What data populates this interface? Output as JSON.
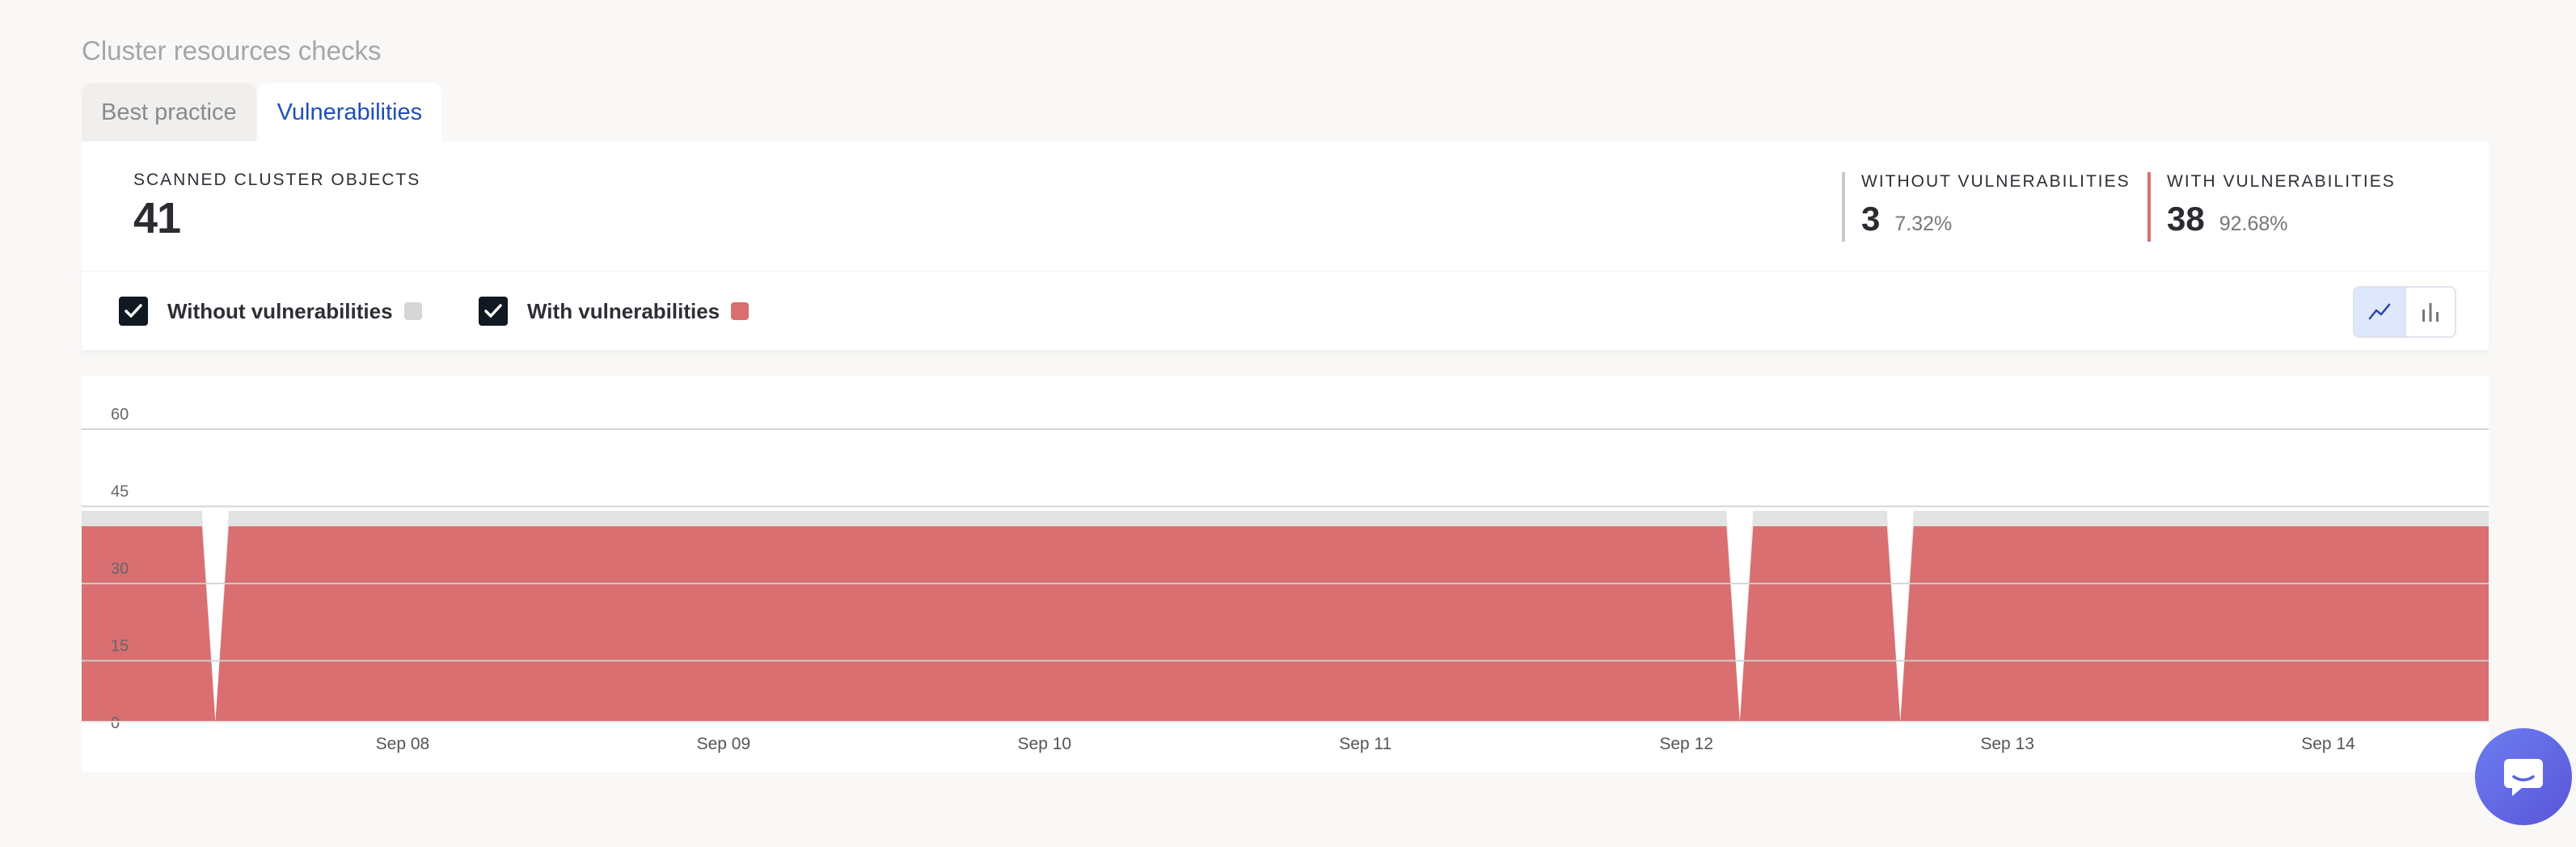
{
  "section": {
    "title": "Cluster resources checks"
  },
  "tabs": [
    {
      "label": "Best practice",
      "active": false
    },
    {
      "label": "Vulnerabilities",
      "active": true
    }
  ],
  "stats": {
    "scanned": {
      "label": "Scanned cluster objects",
      "value": "41"
    },
    "without": {
      "label": "Without vulnerabilities",
      "value": "3",
      "percent": "7.32%",
      "color": "#c9c9c9"
    },
    "with": {
      "label": "With vulnerabilities",
      "value": "38",
      "percent": "92.68%",
      "color": "#d96f70"
    }
  },
  "legend": {
    "without": {
      "label": "Without vulnerabilities",
      "checked": true,
      "color": "#d6d6d6"
    },
    "with": {
      "label": "With vulnerabilities",
      "checked": true,
      "color": "#d96f70"
    }
  },
  "view_toggle": {
    "selected": "line-chart",
    "options": [
      "line-chart-icon",
      "bar-chart-icon"
    ]
  },
  "chat": {
    "icon": "chat-icon"
  },
  "chart_data": {
    "type": "area",
    "stacked": true,
    "ylim": [
      0,
      60
    ],
    "yticks": [
      0,
      15,
      30,
      45,
      60
    ],
    "xticks": [
      "Sep 08",
      "Sep 09",
      "Sep 10",
      "Sep 11",
      "Sep 12",
      "Sep 13",
      "Sep 14"
    ],
    "x_range": [
      "2023-09-07T00:00",
      "2023-09-14T12:00"
    ],
    "grid": true,
    "series": [
      {
        "name": "With vulnerabilities",
        "color": "#d96f70",
        "points": [
          [
            "2023-09-07T00:00",
            38
          ],
          [
            "2023-09-07T09:00",
            38
          ],
          [
            "2023-09-07T10:00",
            0
          ],
          [
            "2023-09-07T11:00",
            38
          ],
          [
            "2023-09-12T03:00",
            38
          ],
          [
            "2023-09-12T04:00",
            0
          ],
          [
            "2023-09-12T05:00",
            38
          ],
          [
            "2023-09-12T15:00",
            38
          ],
          [
            "2023-09-12T16:00",
            0
          ],
          [
            "2023-09-12T17:00",
            38
          ],
          [
            "2023-09-14T12:00",
            38
          ]
        ]
      },
      {
        "name": "Without vulnerabilities",
        "color": "#e3e3e3",
        "points": [
          [
            "2023-09-07T00:00",
            3
          ],
          [
            "2023-09-07T09:00",
            3
          ],
          [
            "2023-09-07T10:00",
            0
          ],
          [
            "2023-09-07T11:00",
            3
          ],
          [
            "2023-09-12T03:00",
            3
          ],
          [
            "2023-09-12T04:00",
            0
          ],
          [
            "2023-09-12T05:00",
            3
          ],
          [
            "2023-09-12T15:00",
            3
          ],
          [
            "2023-09-12T16:00",
            0
          ],
          [
            "2023-09-12T17:00",
            3
          ],
          [
            "2023-09-14T12:00",
            3
          ]
        ]
      }
    ]
  }
}
